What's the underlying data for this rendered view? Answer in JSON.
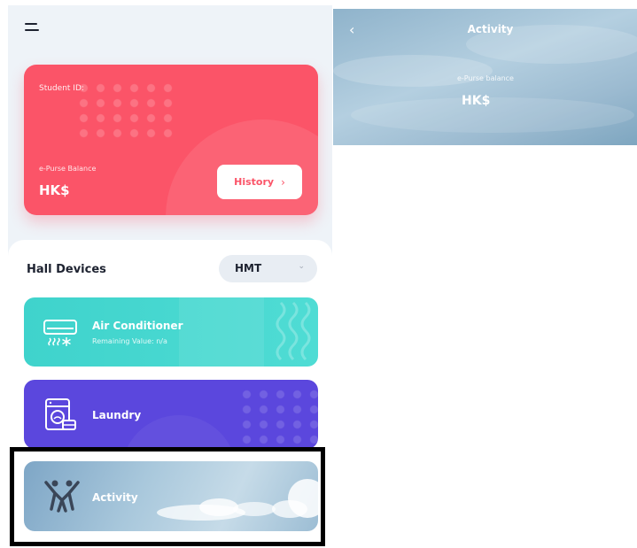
{
  "left_screen": {
    "student_card": {
      "student_id_label": "Student ID:",
      "balance_label": "e-Purse Balance",
      "balance_value": "HK$",
      "history_button": "History",
      "history_chevron": "›",
      "color": "#fb5468"
    },
    "hall_devices": {
      "title": "Hall Devices",
      "selected_hall": "HMT",
      "select_arrow": "⌄"
    },
    "devices": [
      {
        "name": "Air Conditioner",
        "subtitle": "Remaining Value: n/a",
        "icon": "air-conditioner-icon",
        "color": "#3fd3cc"
      },
      {
        "name": "Laundry",
        "icon": "washing-machine-icon",
        "color": "#5b47dd"
      },
      {
        "name": "Activity",
        "icon": "activity-people-icon",
        "color": "#9cbdd4"
      }
    ]
  },
  "right_screen": {
    "back_icon": "‹",
    "title": "Activity",
    "balance_label": "e-Purse balance",
    "balance_value": "HK$"
  }
}
